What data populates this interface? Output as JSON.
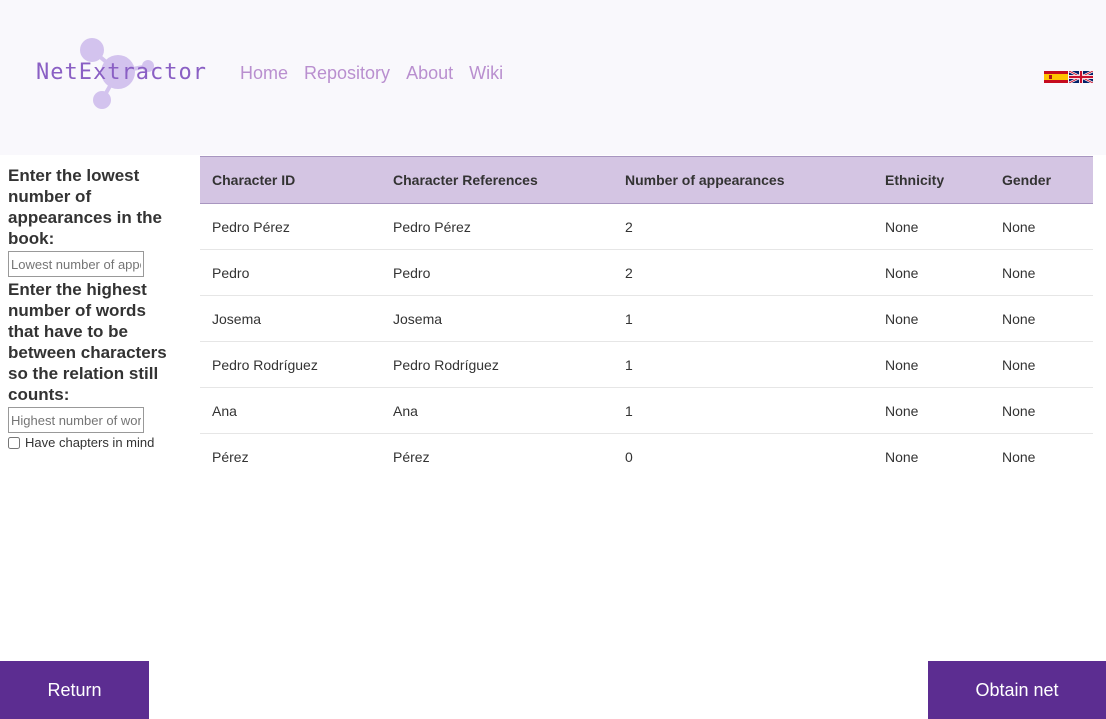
{
  "header": {
    "logo_text": "NetExtractor",
    "nav": [
      "Home",
      "Repository",
      "About",
      "Wiki"
    ]
  },
  "sidebar": {
    "min_appearances_label": "Enter the lowest number of appearances in the book:",
    "min_appearances_placeholder": "Lowest number of appearances",
    "max_words_label": "Enter the highest number of words that have to be between characters so the relation still counts:",
    "max_words_placeholder": "Highest number of words",
    "chapters_label": "Have chapters in mind"
  },
  "table": {
    "headers": [
      "Character ID",
      "Character References",
      "Number of appearances",
      "Ethnicity",
      "Gender"
    ],
    "rows": [
      [
        "Pedro Pérez",
        "Pedro Pérez",
        "2",
        "None",
        "None"
      ],
      [
        "Pedro",
        "Pedro",
        "2",
        "None",
        "None"
      ],
      [
        "Josema",
        "Josema",
        "1",
        "None",
        "None"
      ],
      [
        "Pedro Rodríguez",
        "Pedro Rodríguez",
        "1",
        "None",
        "None"
      ],
      [
        "Ana",
        "Ana",
        "1",
        "None",
        "None"
      ],
      [
        "Pérez",
        "Pérez",
        "0",
        "None",
        "None"
      ]
    ]
  },
  "buttons": {
    "return": "Return",
    "obtain": "Obtain net"
  },
  "colors": {
    "header_bg": "#f9f8fc",
    "nav_text": "#b98fcf",
    "table_header_bg": "#d4c5e3",
    "button_bg": "#5c2d91"
  }
}
